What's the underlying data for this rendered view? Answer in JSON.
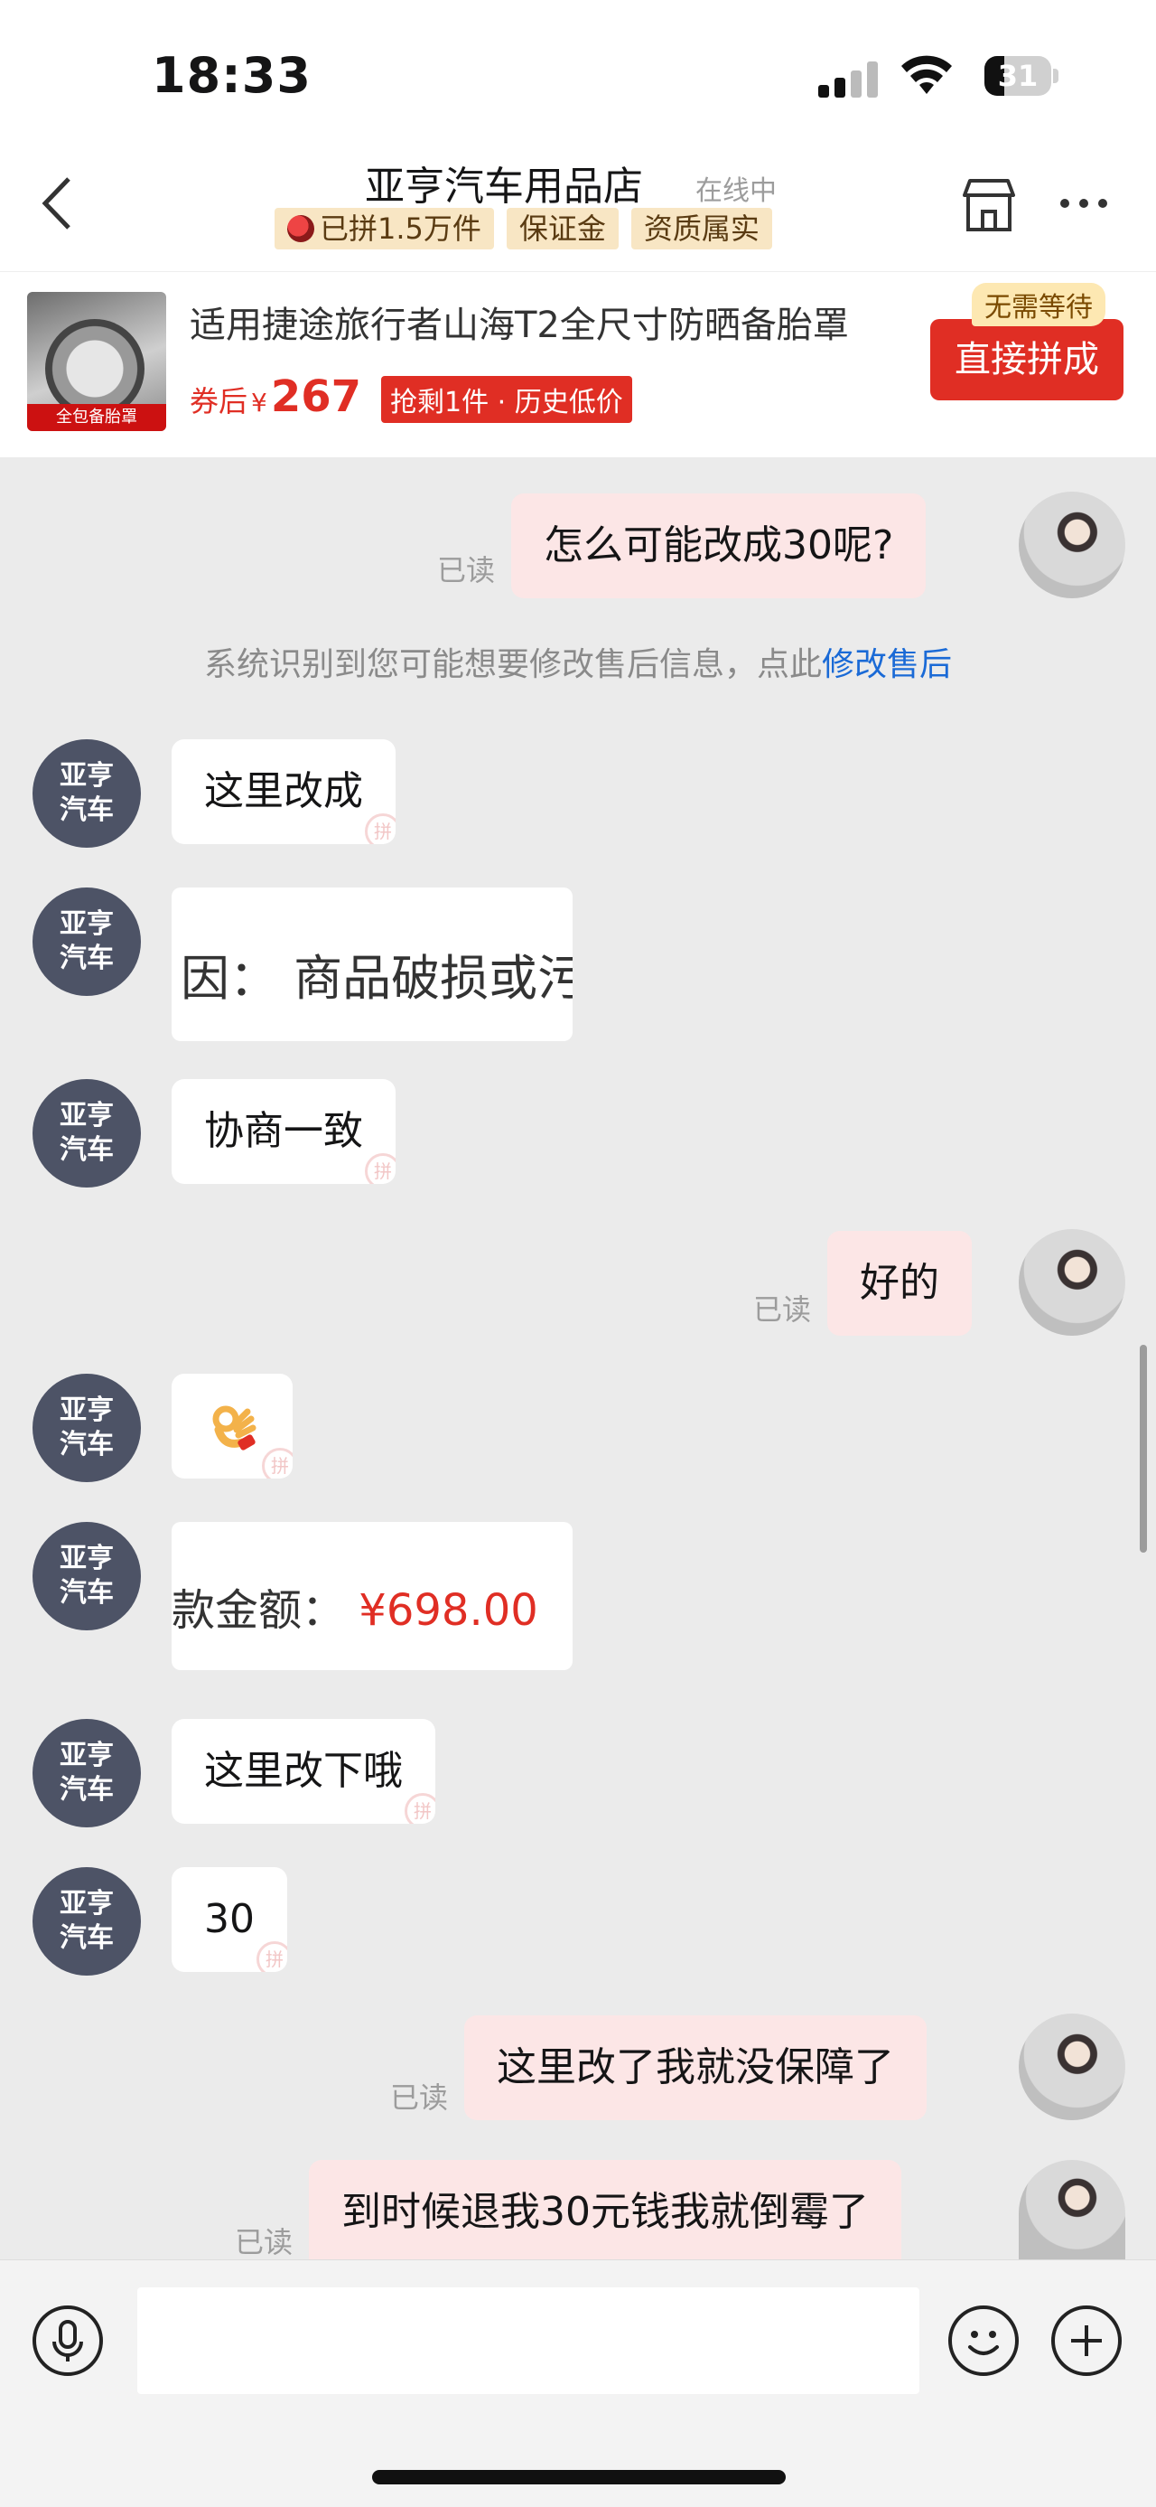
{
  "status_bar": {
    "time": "18:33",
    "battery": "31"
  },
  "header": {
    "back_icon": "chevron-left-icon",
    "shop_name": "亚亨汽车用品店",
    "online_status": "在线中",
    "tags": [
      "已拼1.5万件",
      "保证金",
      "资质属实"
    ],
    "store_icon": "store-icon",
    "more_icon": "more-icon"
  },
  "product": {
    "thumb_banner": "全包备胎罩",
    "title": "适用捷途旅行者山海T2全尺寸防晒备胎罩",
    "after_coupon_label": "券后",
    "currency": "¥",
    "price": "267",
    "promo": "抢剩1件 · 历史低价",
    "no_wait_badge": "无需等待",
    "buy_button": "直接拼成"
  },
  "chat": {
    "shop_avatar_text": "亚亨\n汽车",
    "read_label": "已读",
    "system_notice": "系统识别到您可能想要修改售后信息，点此",
    "system_link": "修改售后",
    "messages": [
      {
        "from": "me",
        "text": "怎么可能改成30呢?"
      },
      {
        "from": "shop",
        "text": "这里改成"
      },
      {
        "from": "shop",
        "type": "image",
        "text": "因：  商品破损或污"
      },
      {
        "from": "shop",
        "text": "协商一致"
      },
      {
        "from": "me",
        "text": "好的"
      },
      {
        "from": "shop",
        "type": "emoji",
        "emoji": "ok-hand-icon"
      },
      {
        "from": "shop",
        "type": "image",
        "label": "款金额：",
        "amount": "¥698.00"
      },
      {
        "from": "shop",
        "text": "这里改下哦"
      },
      {
        "from": "shop",
        "text": "30"
      },
      {
        "from": "me",
        "text": "这里改了我就没保障了"
      },
      {
        "from": "me",
        "text": "到时候退我30元钱我就倒霉了"
      }
    ]
  },
  "input_bar": {
    "voice_icon": "microphone-icon",
    "emoji_icon": "smiley-icon",
    "plus_icon": "plus-icon",
    "placeholder": ""
  }
}
